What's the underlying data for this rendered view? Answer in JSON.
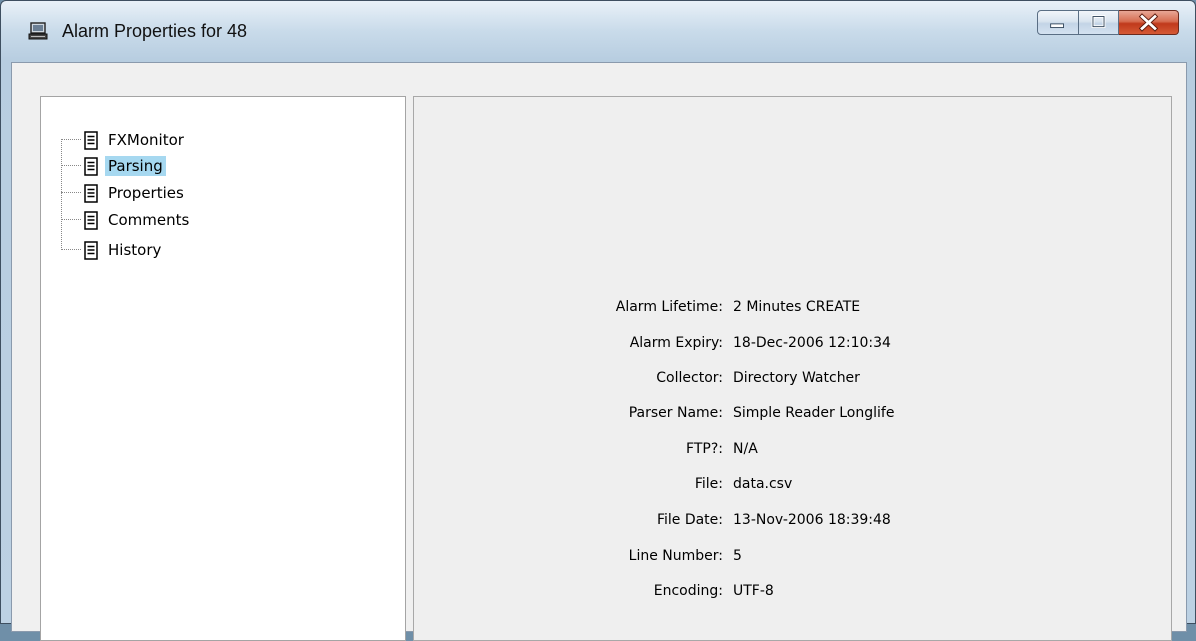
{
  "window": {
    "title": "Alarm Properties for 48",
    "icon": "computer-icon",
    "caption_buttons": [
      "minimize-icon",
      "maximize-icon",
      "close-icon"
    ]
  },
  "tree": {
    "items": [
      {
        "label": "FXMonitor",
        "icon": "document-icon",
        "selected": false
      },
      {
        "label": "Parsing",
        "icon": "document-icon",
        "selected": true
      },
      {
        "label": "Properties",
        "icon": "document-icon",
        "selected": false
      },
      {
        "label": "Comments",
        "icon": "document-icon",
        "selected": false
      },
      {
        "label": "History",
        "icon": "document-icon",
        "selected": false
      }
    ]
  },
  "details": {
    "rows": [
      {
        "label": "Alarm Lifetime:",
        "value": "2 Minutes CREATE"
      },
      {
        "label": "Alarm Expiry:",
        "value": "18-Dec-2006 12:10:34"
      },
      {
        "label": "Collector:",
        "value": "Directory Watcher"
      },
      {
        "label": "Parser Name:",
        "value": "Simple Reader Longlife"
      },
      {
        "label": "FTP?:",
        "value": "N/A"
      },
      {
        "label": "File:",
        "value": "data.csv"
      },
      {
        "label": "File Date:",
        "value": "13-Nov-2006 18:39:48"
      },
      {
        "label": "Line Number:",
        "value": "5"
      },
      {
        "label": "Encoding:",
        "value": "UTF-8"
      }
    ]
  },
  "colors": {
    "selection": "#a6d8f0",
    "close_button": "#c0391c"
  }
}
